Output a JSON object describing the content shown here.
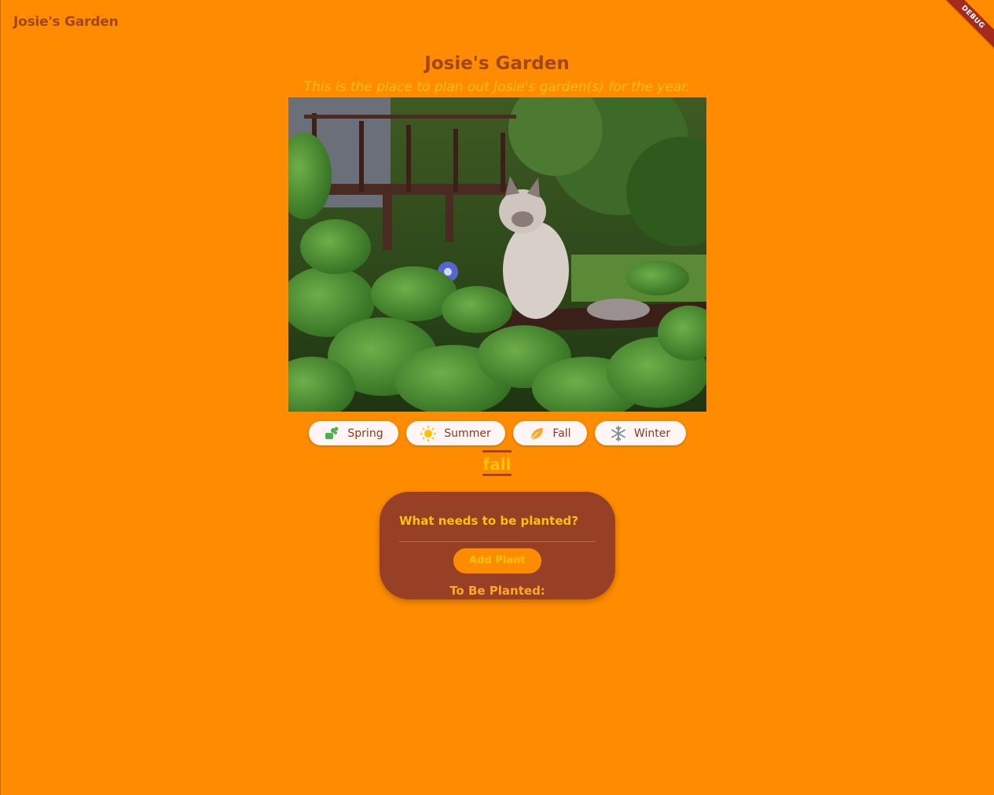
{
  "appbar": {
    "title": "Josie's Garden"
  },
  "debug_banner": "DEBUG",
  "header": {
    "title": "Josie's Garden",
    "subtitle": "This is the place to plan out Josie's garden(s) for the year."
  },
  "photo": {
    "subject": "cat sitting among garden plants"
  },
  "seasons": [
    {
      "label": "Spring",
      "icon": "sprout-icon",
      "color": "#4CAF50"
    },
    {
      "label": "Summer",
      "icon": "sun-icon",
      "color": "#FFC107"
    },
    {
      "label": "Fall",
      "icon": "leaf-icon",
      "color": "#FFA726"
    },
    {
      "label": "Winter",
      "icon": "snowflake-icon",
      "color": "#78909C"
    }
  ],
  "selected_season": "fall",
  "planting_card": {
    "question": "What needs to be planted?",
    "input_value": "",
    "add_button": "Add Plant",
    "list_heading": "To Be Planted:"
  },
  "colors": {
    "background": "#FF8C00",
    "primary_text": "#A0471F",
    "accent": "#FFC107",
    "card": "#974025",
    "chip": "#FFF5F5"
  }
}
